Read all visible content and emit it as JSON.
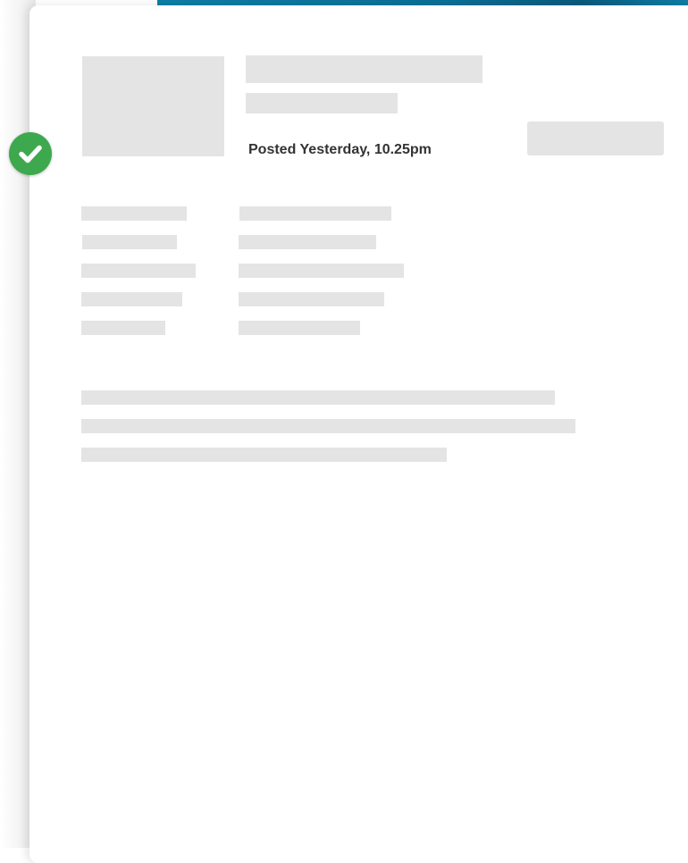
{
  "post": {
    "posted_text": "Posted Yesterday, 10.25pm"
  },
  "colors": {
    "accent_band": "#0e7ea6",
    "status_badge": "#3ea84f",
    "placeholder": "#e4e4e4",
    "meta_text": "#333333"
  },
  "icons": {
    "status": "check-icon"
  }
}
